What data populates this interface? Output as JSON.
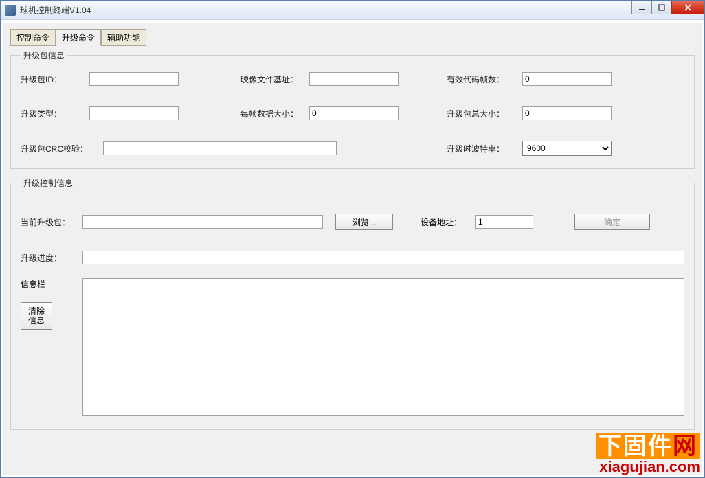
{
  "window": {
    "title": "球机控制终端V1.04"
  },
  "tabs": {
    "t0": "控制命令",
    "t1": "升级命令",
    "t2": "辅助功能",
    "active": 1
  },
  "group1": {
    "legend": "升级包信息",
    "labels": {
      "pkg_id": "升级包ID：",
      "img_base": "映像文件基址：",
      "valid_frames": "有效代码帧数：",
      "pkg_type": "升级类型：",
      "frame_size": "每帧数据大小：",
      "pkg_total": "升级包总大小：",
      "crc": "升级包CRC校验：",
      "baud": "升级时波特率："
    },
    "values": {
      "pkg_id": "",
      "img_base": "",
      "valid_frames": "0",
      "pkg_type": "",
      "frame_size": "0",
      "pkg_total": "0",
      "crc": "",
      "baud": "9600"
    },
    "baud_options": [
      "9600"
    ]
  },
  "group2": {
    "legend": "升级控制信息",
    "labels": {
      "current_pkg": "当前升级包：",
      "browse": "浏览...",
      "dev_addr": "设备地址：",
      "ok": "确定",
      "progress": "升级进度：",
      "info": "信息栏",
      "clear": "清除\n信息"
    },
    "values": {
      "current_pkg": "",
      "dev_addr": "1",
      "log": ""
    }
  },
  "watermark": {
    "line1a": "下固件",
    "line1b": "网",
    "line2": "xiagujian.com"
  }
}
